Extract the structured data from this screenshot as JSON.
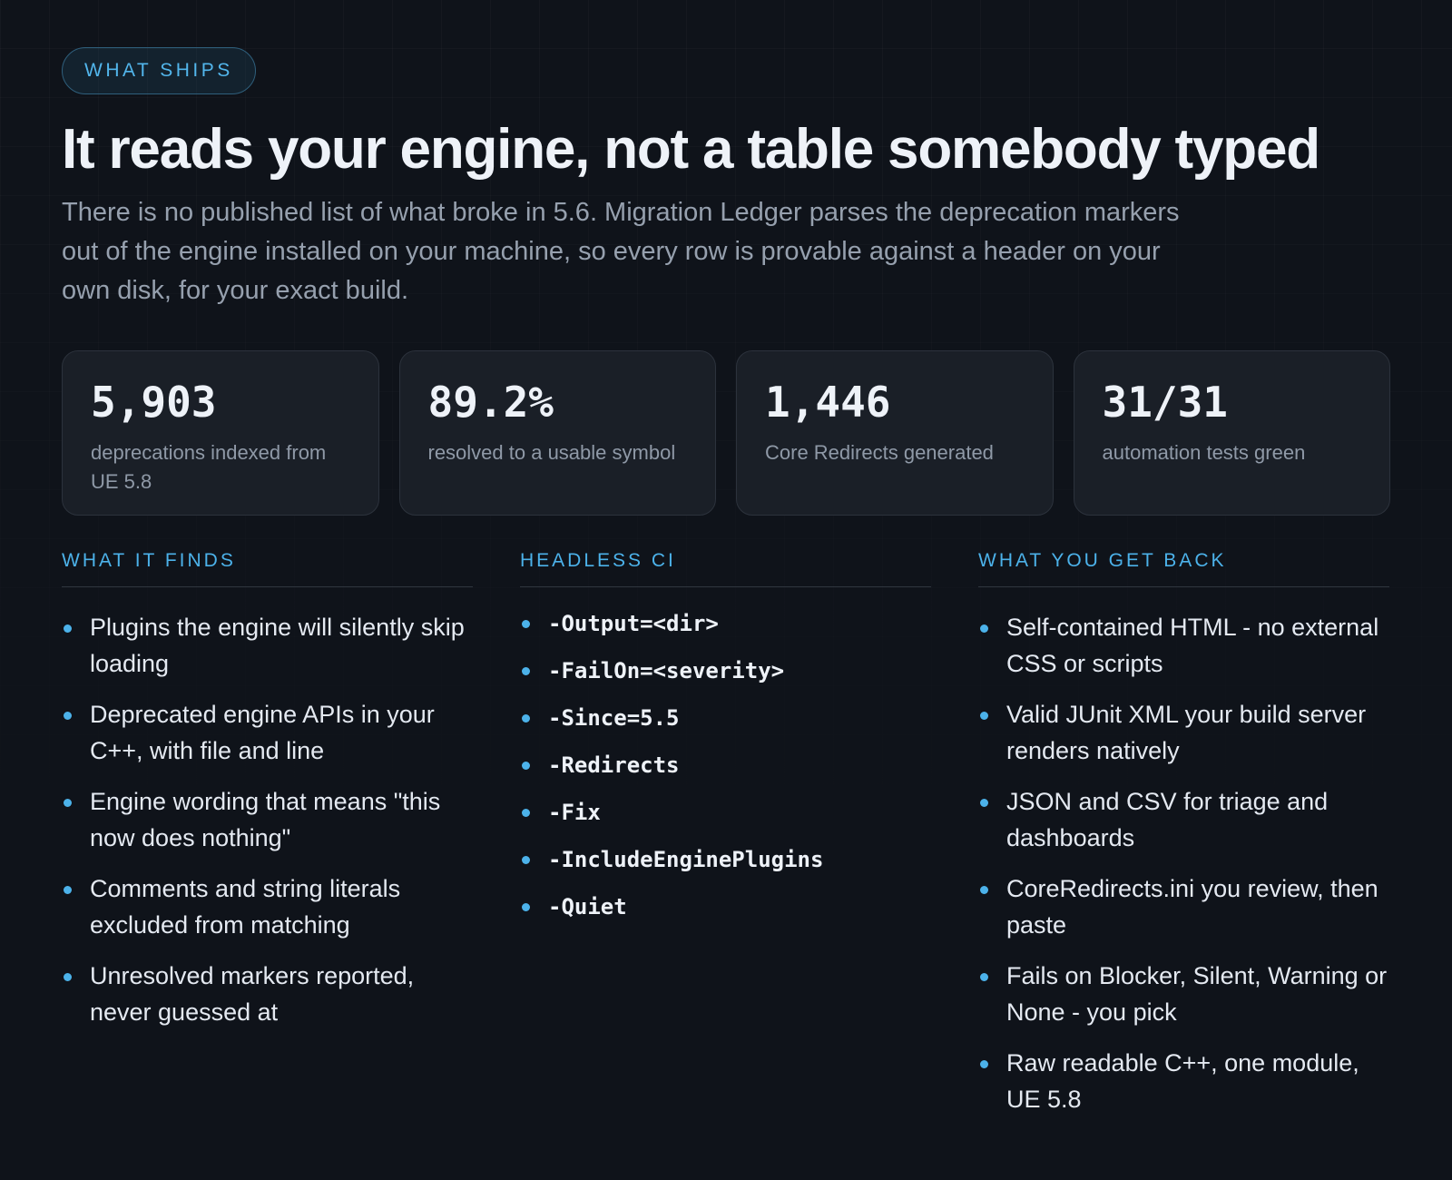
{
  "badge": "WHAT SHIPS",
  "headline": "It reads your engine, not a table somebody typed",
  "subheadline": "There is no published list of what broke in 5.6. Migration Ledger parses the deprecation markers out of the engine installed on your machine, so every row is provable against a header on your own disk, for your exact build.",
  "stats": [
    {
      "value": "5,903",
      "label": "deprecations indexed from UE 5.8"
    },
    {
      "value": "89.2%",
      "label": "resolved to a usable symbol"
    },
    {
      "value": "1,446",
      "label": "Core Redirects generated"
    },
    {
      "value": "31/31",
      "label": "automation tests green"
    }
  ],
  "columns": {
    "finds": {
      "title": "WHAT IT FINDS",
      "items": [
        "Plugins the engine will silently skip loading",
        "Deprecated engine APIs in your C++, with file and line",
        "Engine wording that means \"this now does nothing\"",
        "Comments and string literals excluded from matching",
        "Unresolved markers reported, never guessed at"
      ]
    },
    "ci": {
      "title": "HEADLESS CI",
      "items": [
        "-Output=<dir>",
        "-FailOn=<severity>",
        "-Since=5.5",
        "-Redirects",
        "-Fix",
        "-IncludeEnginePlugins",
        "-Quiet"
      ]
    },
    "back": {
      "title": "WHAT YOU GET BACK",
      "items": [
        "Self-contained HTML - no external CSS or scripts",
        "Valid JUnit XML your build server renders natively",
        "JSON and CSV for triage and dashboards",
        "CoreRedirects.ini you review, then paste",
        "Fails on Blocker, Silent, Warning or None - you pick",
        "Raw readable C++, one module, UE 5.8"
      ]
    }
  },
  "colors": {
    "accent": "#4cb2ea",
    "background": "#0f131a",
    "card": "#1a1f27"
  }
}
